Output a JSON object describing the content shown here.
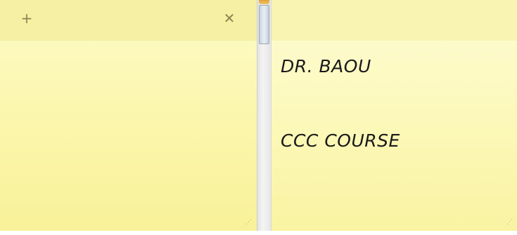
{
  "left_note": {
    "add_icon": "+",
    "close_icon": "✕",
    "resize_grip": "⋰"
  },
  "right_note": {
    "lines": [
      "DR. BAOU",
      "CCC COURSE"
    ],
    "resize_grip": "⋰"
  },
  "colors": {
    "note_yellow": "#fbf6ab",
    "titlebar_yellow": "#f6f0a4",
    "scroll_accent": "#e2a23a",
    "icon_gray": "#8a8450"
  },
  "icons": {
    "add": "plus-icon",
    "close": "close-icon",
    "grip": "resize-grip-icon"
  }
}
